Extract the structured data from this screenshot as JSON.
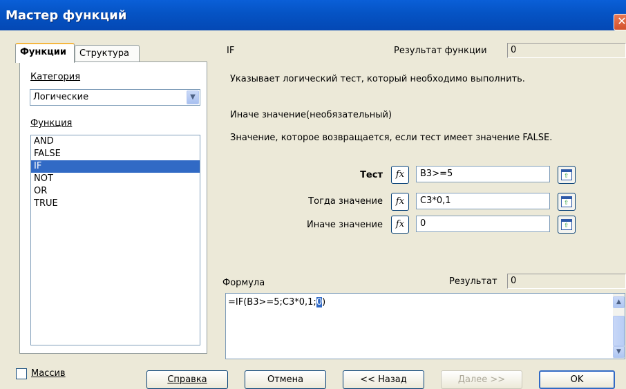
{
  "window": {
    "title": "Мастер функций"
  },
  "tabs": [
    {
      "label": "Функции"
    },
    {
      "label": "Структура"
    }
  ],
  "left": {
    "category_label": "Категория",
    "category_value": "Логические",
    "function_label": "Функция",
    "functions": [
      "AND",
      "FALSE",
      "IF",
      "NOT",
      "OR",
      "TRUE"
    ],
    "selected_function": "IF"
  },
  "right": {
    "function_name": "IF",
    "result_label": "Результат функции",
    "result_value": "0",
    "description": "Указывает логический тест, который необходимо выполнить.",
    "arg_title": "Иначе значение(необязательный)",
    "arg_description": "Значение, которое возвращается, если тест имеет значение FALSE.",
    "args": [
      {
        "label": "Тест",
        "value": "B3>=5"
      },
      {
        "label": "Тогда значение",
        "value": "C3*0,1"
      },
      {
        "label": "Иначе значение",
        "value": "0"
      }
    ],
    "fx_glyph": "fx",
    "formula_label": "Формула",
    "formula_result_label": "Результат",
    "formula_result_value": "0",
    "formula_prefix": "=IF(B3>=5;C3*0,1;",
    "formula_selected": "0",
    "formula_suffix": ")"
  },
  "bottom": {
    "array_label": "Массив",
    "help": "Справка",
    "cancel": "Отмена",
    "back": "<< Назад",
    "next": "Далее >>",
    "ok": "OK"
  },
  "icons": {
    "close": "✕",
    "dropdown": "▼",
    "scroll_up": "▲",
    "scroll_down": "▼",
    "shrink_arrow": "⇧"
  },
  "colors": {
    "title_bar": "#0553c4",
    "selection": "#316ac5",
    "dialog_bg": "#ece9d8"
  }
}
